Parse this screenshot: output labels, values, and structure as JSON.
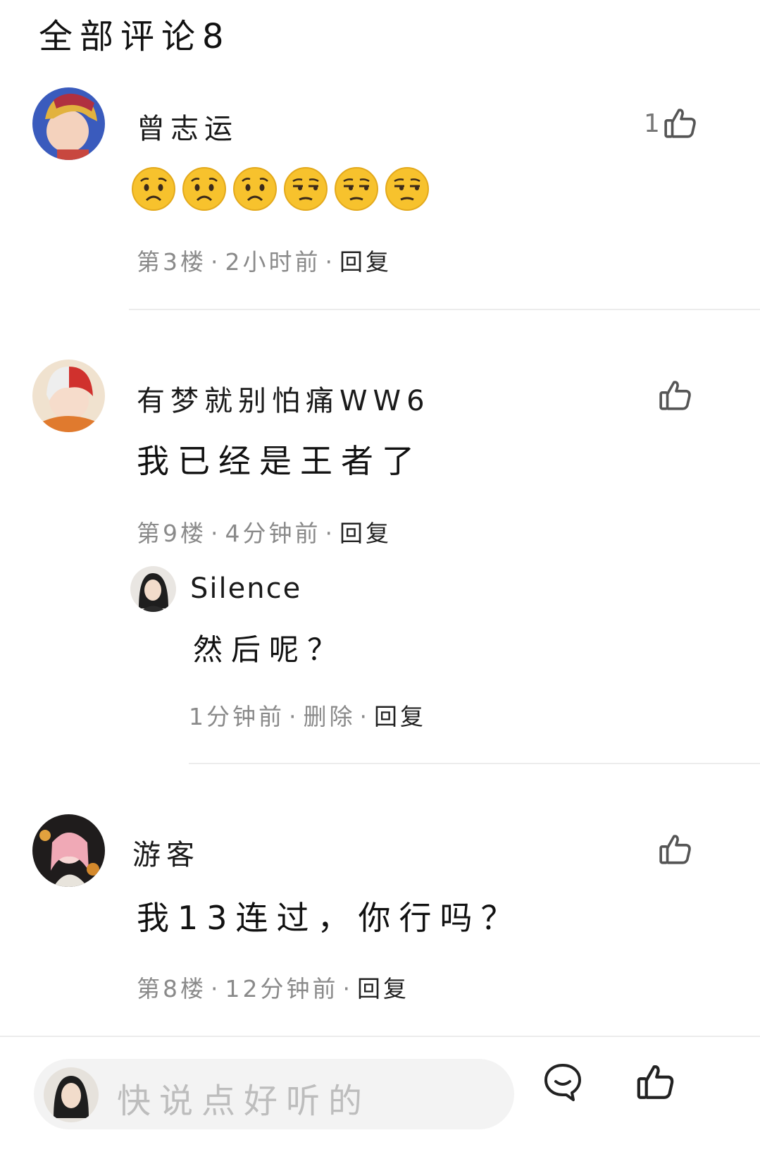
{
  "header": {
    "title": "全部评论8"
  },
  "comments": [
    {
      "username": "曾志运",
      "content_emojis": [
        "worried",
        "worried",
        "worried",
        "unamused",
        "unamused",
        "unamused"
      ],
      "floor": "第3楼",
      "time": "2小时前",
      "reply_label": "回复",
      "likes": "1"
    },
    {
      "username": "有梦就别怕痛WW6",
      "content": "我已经是王者了",
      "floor": "第9楼",
      "time": "4分钟前",
      "reply_label": "回复",
      "likes": "",
      "sub_reply": {
        "username": "Silence",
        "content": "然后呢？",
        "time": "1分钟前",
        "delete_label": "删除",
        "reply_label": "回复"
      }
    },
    {
      "username": "游客",
      "content": "我13连过，你行吗？",
      "floor": "第8楼",
      "time": "12分钟前",
      "reply_label": "回复",
      "likes": ""
    }
  ],
  "input": {
    "placeholder": "快说点好听的"
  },
  "icons": {
    "like": "thumbs-up-icon",
    "comment": "chat-bubble-icon"
  },
  "colors": {
    "meta_gray": "#8a8a8a",
    "divider": "#ececec",
    "emoji_yellow": "#f7c22d"
  }
}
